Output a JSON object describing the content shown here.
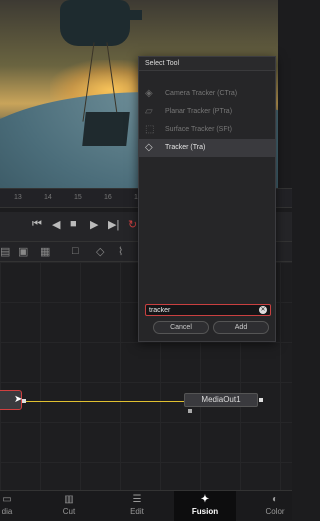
{
  "viewer": {
    "ruler_ticks": [
      "13",
      "14",
      "15",
      "16",
      "17",
      "18",
      "19",
      "20",
      "21",
      "22",
      "23"
    ]
  },
  "transport": {
    "icons": [
      "skip-back-icon",
      "step-back-icon",
      "stop-icon",
      "play-icon",
      "step-forward-icon",
      "loop-icon"
    ]
  },
  "dialog": {
    "title": "Select Tool",
    "items": [
      {
        "label": "Camera Tracker (CTra)",
        "icon": "camera-tracker-icon"
      },
      {
        "label": "Planar Tracker (PTra)",
        "icon": "planar-tracker-icon"
      },
      {
        "label": "Surface Tracker (SFt)",
        "icon": "surface-tracker-icon"
      },
      {
        "label": "Tracker (Tra)",
        "icon": "tracker-icon",
        "selected": true
      }
    ],
    "search_value": "tracker",
    "cancel_label": "Cancel",
    "add_label": "Add"
  },
  "node_editor": {
    "output_node_label": "MediaOut1"
  },
  "bottom_nav": {
    "items": [
      {
        "label": "dia",
        "icon": "media-icon"
      },
      {
        "label": "Cut",
        "icon": "cut-icon"
      },
      {
        "label": "Edit",
        "icon": "edit-icon"
      },
      {
        "label": "Fusion",
        "icon": "fusion-icon",
        "active": true
      },
      {
        "label": "Color",
        "icon": "color-icon"
      }
    ]
  },
  "colors": {
    "accent_red": "#c94040",
    "link_yellow": "#e0c030"
  }
}
